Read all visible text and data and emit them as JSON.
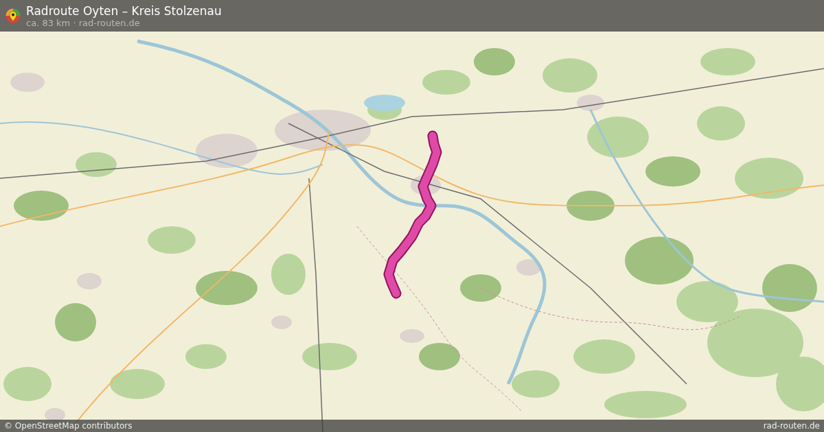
{
  "header": {
    "title": "Radroute Oyten – Kreis Stolzenau",
    "subtitle": "ca. 83 km · rad-routen.de"
  },
  "footer": {
    "attribution": "© OpenStreetMap contributors",
    "site": "rad-routen.de"
  }
}
